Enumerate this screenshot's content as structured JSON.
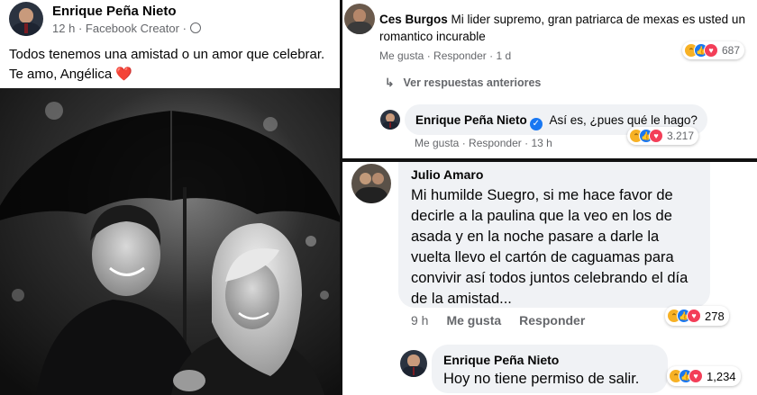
{
  "post": {
    "author": "Enrique Peña Nieto",
    "time": "12 h",
    "separator": "·",
    "source": "Facebook Creator",
    "text": "Todos tenemos una amistad o un amor que celebrar. Te amo, Angélica",
    "heart": "❤️"
  },
  "top_thread": {
    "comment": {
      "author": "Ces Burgos",
      "text": "Mi lider supremo, gran patriarca de mexas es usted un romantico incurable",
      "actions": [
        "Me gusta",
        "Responder",
        "1 d"
      ],
      "reaction_count": "687"
    },
    "view_previous": "Ver respuestas anteriores",
    "reply": {
      "author": "Enrique Peña Nieto",
      "text": "Así es, ¿pues qué le hago?",
      "actions": [
        "Me gusta",
        "Responder",
        "13 h"
      ],
      "reaction_count": "3.217"
    }
  },
  "bottom_thread": {
    "comment": {
      "author": "Julio Amaro",
      "text": "Mi humilde Suegro, si me hace favor de decirle a la paulina que la veo en los de asada y en la noche pasare a darle la vuelta llevo el cartón de caguamas para convivir así todos juntos celebrando el día de la amistad...",
      "actions": [
        "9 h",
        "Me gusta",
        "Responder"
      ],
      "reaction_count": "278"
    },
    "reply": {
      "author": "Enrique Peña Nieto",
      "text": "Hoy no tiene permiso de salir.",
      "reaction_count": "1,234"
    }
  },
  "colors": {
    "like": "#1877f2",
    "love": "#f33e58",
    "haha": "#f7b125",
    "bubble": "#f0f2f5"
  }
}
